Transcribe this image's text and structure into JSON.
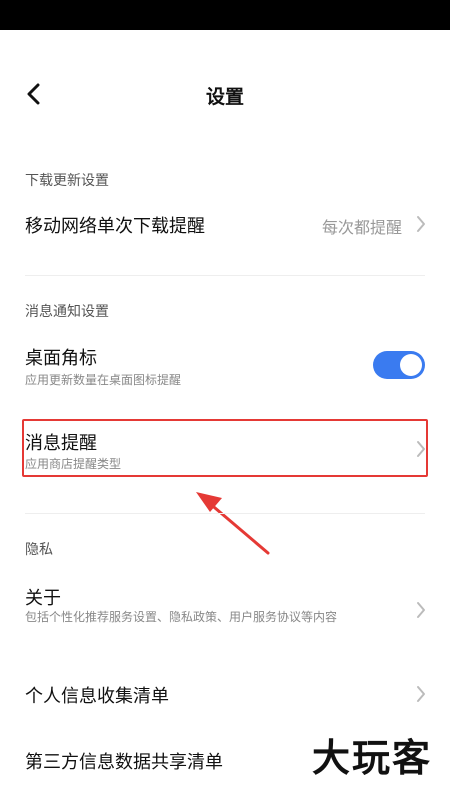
{
  "header": {
    "title": "设置"
  },
  "sections": {
    "download": {
      "label": "下载更新设置",
      "mobile_prompt": {
        "title": "移动网络单次下载提醒",
        "value": "每次都提醒"
      }
    },
    "notification": {
      "label": "消息通知设置",
      "badge": {
        "title": "桌面角标",
        "subtitle": "应用更新数量在桌面图标提醒",
        "enabled": true
      },
      "message": {
        "title": "消息提醒",
        "subtitle": "应用商店提醒类型"
      }
    },
    "privacy": {
      "label": "隐私",
      "about": {
        "title": "关于",
        "subtitle": "包括个性化推荐服务设置、隐私政策、用户服务协议等内容"
      },
      "personal_info": {
        "title": "个人信息收集清单"
      },
      "third_party": {
        "title": "第三方信息数据共享清单"
      }
    }
  },
  "colors": {
    "accent": "#3a7bf0",
    "highlight": "#e53935"
  },
  "watermark": {
    "text": "大玩客"
  }
}
